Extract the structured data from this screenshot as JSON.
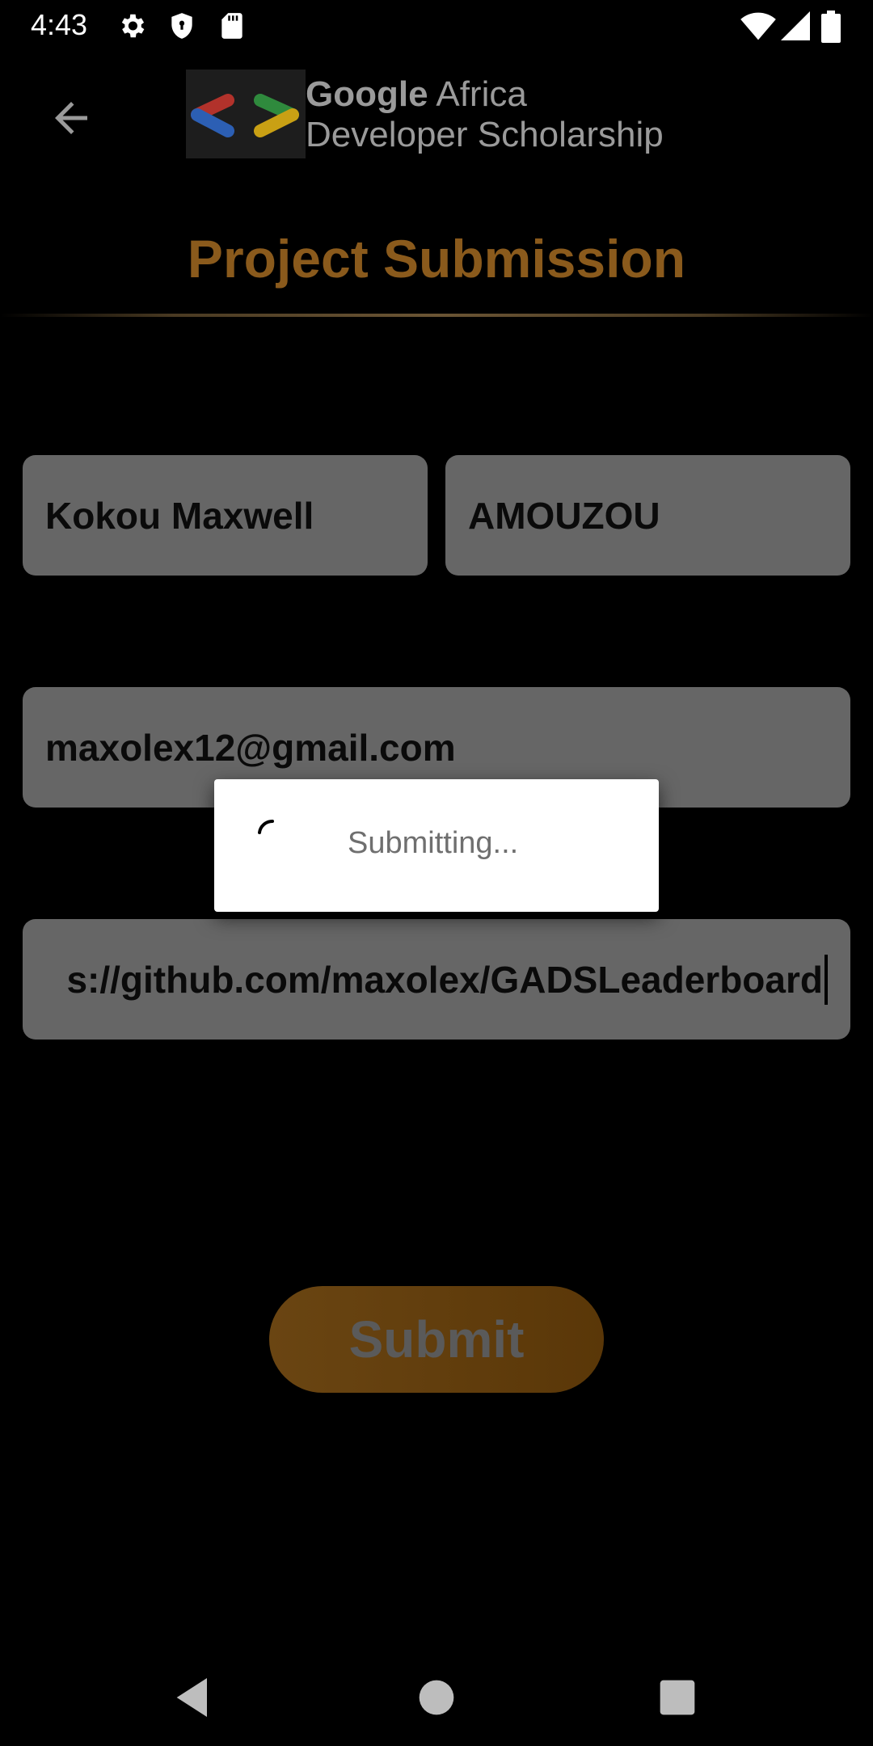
{
  "status_bar": {
    "time": "4:43",
    "icons": [
      "settings-icon",
      "shield-icon",
      "sd-card-icon",
      "wifi-icon",
      "signal-icon",
      "battery-icon"
    ]
  },
  "app_bar": {
    "back_icon": "arrow-left-icon",
    "logo": {
      "brand": "Google",
      "line1_rest": " Africa",
      "line2": "Developer Scholarship"
    }
  },
  "page": {
    "title": "Project Submission"
  },
  "form": {
    "first_name": "Kokou Maxwell",
    "last_name": "AMOUZOU",
    "email": "maxolex12@gmail.com",
    "project_link": "s://github.com/maxolex/GADSLeaderboard",
    "submit_label": "Submit"
  },
  "dialog": {
    "message": "Submitting..."
  },
  "colors": {
    "title": "#8a5a1c",
    "field_bg": "#666666",
    "button_bg": "#6a4512"
  }
}
